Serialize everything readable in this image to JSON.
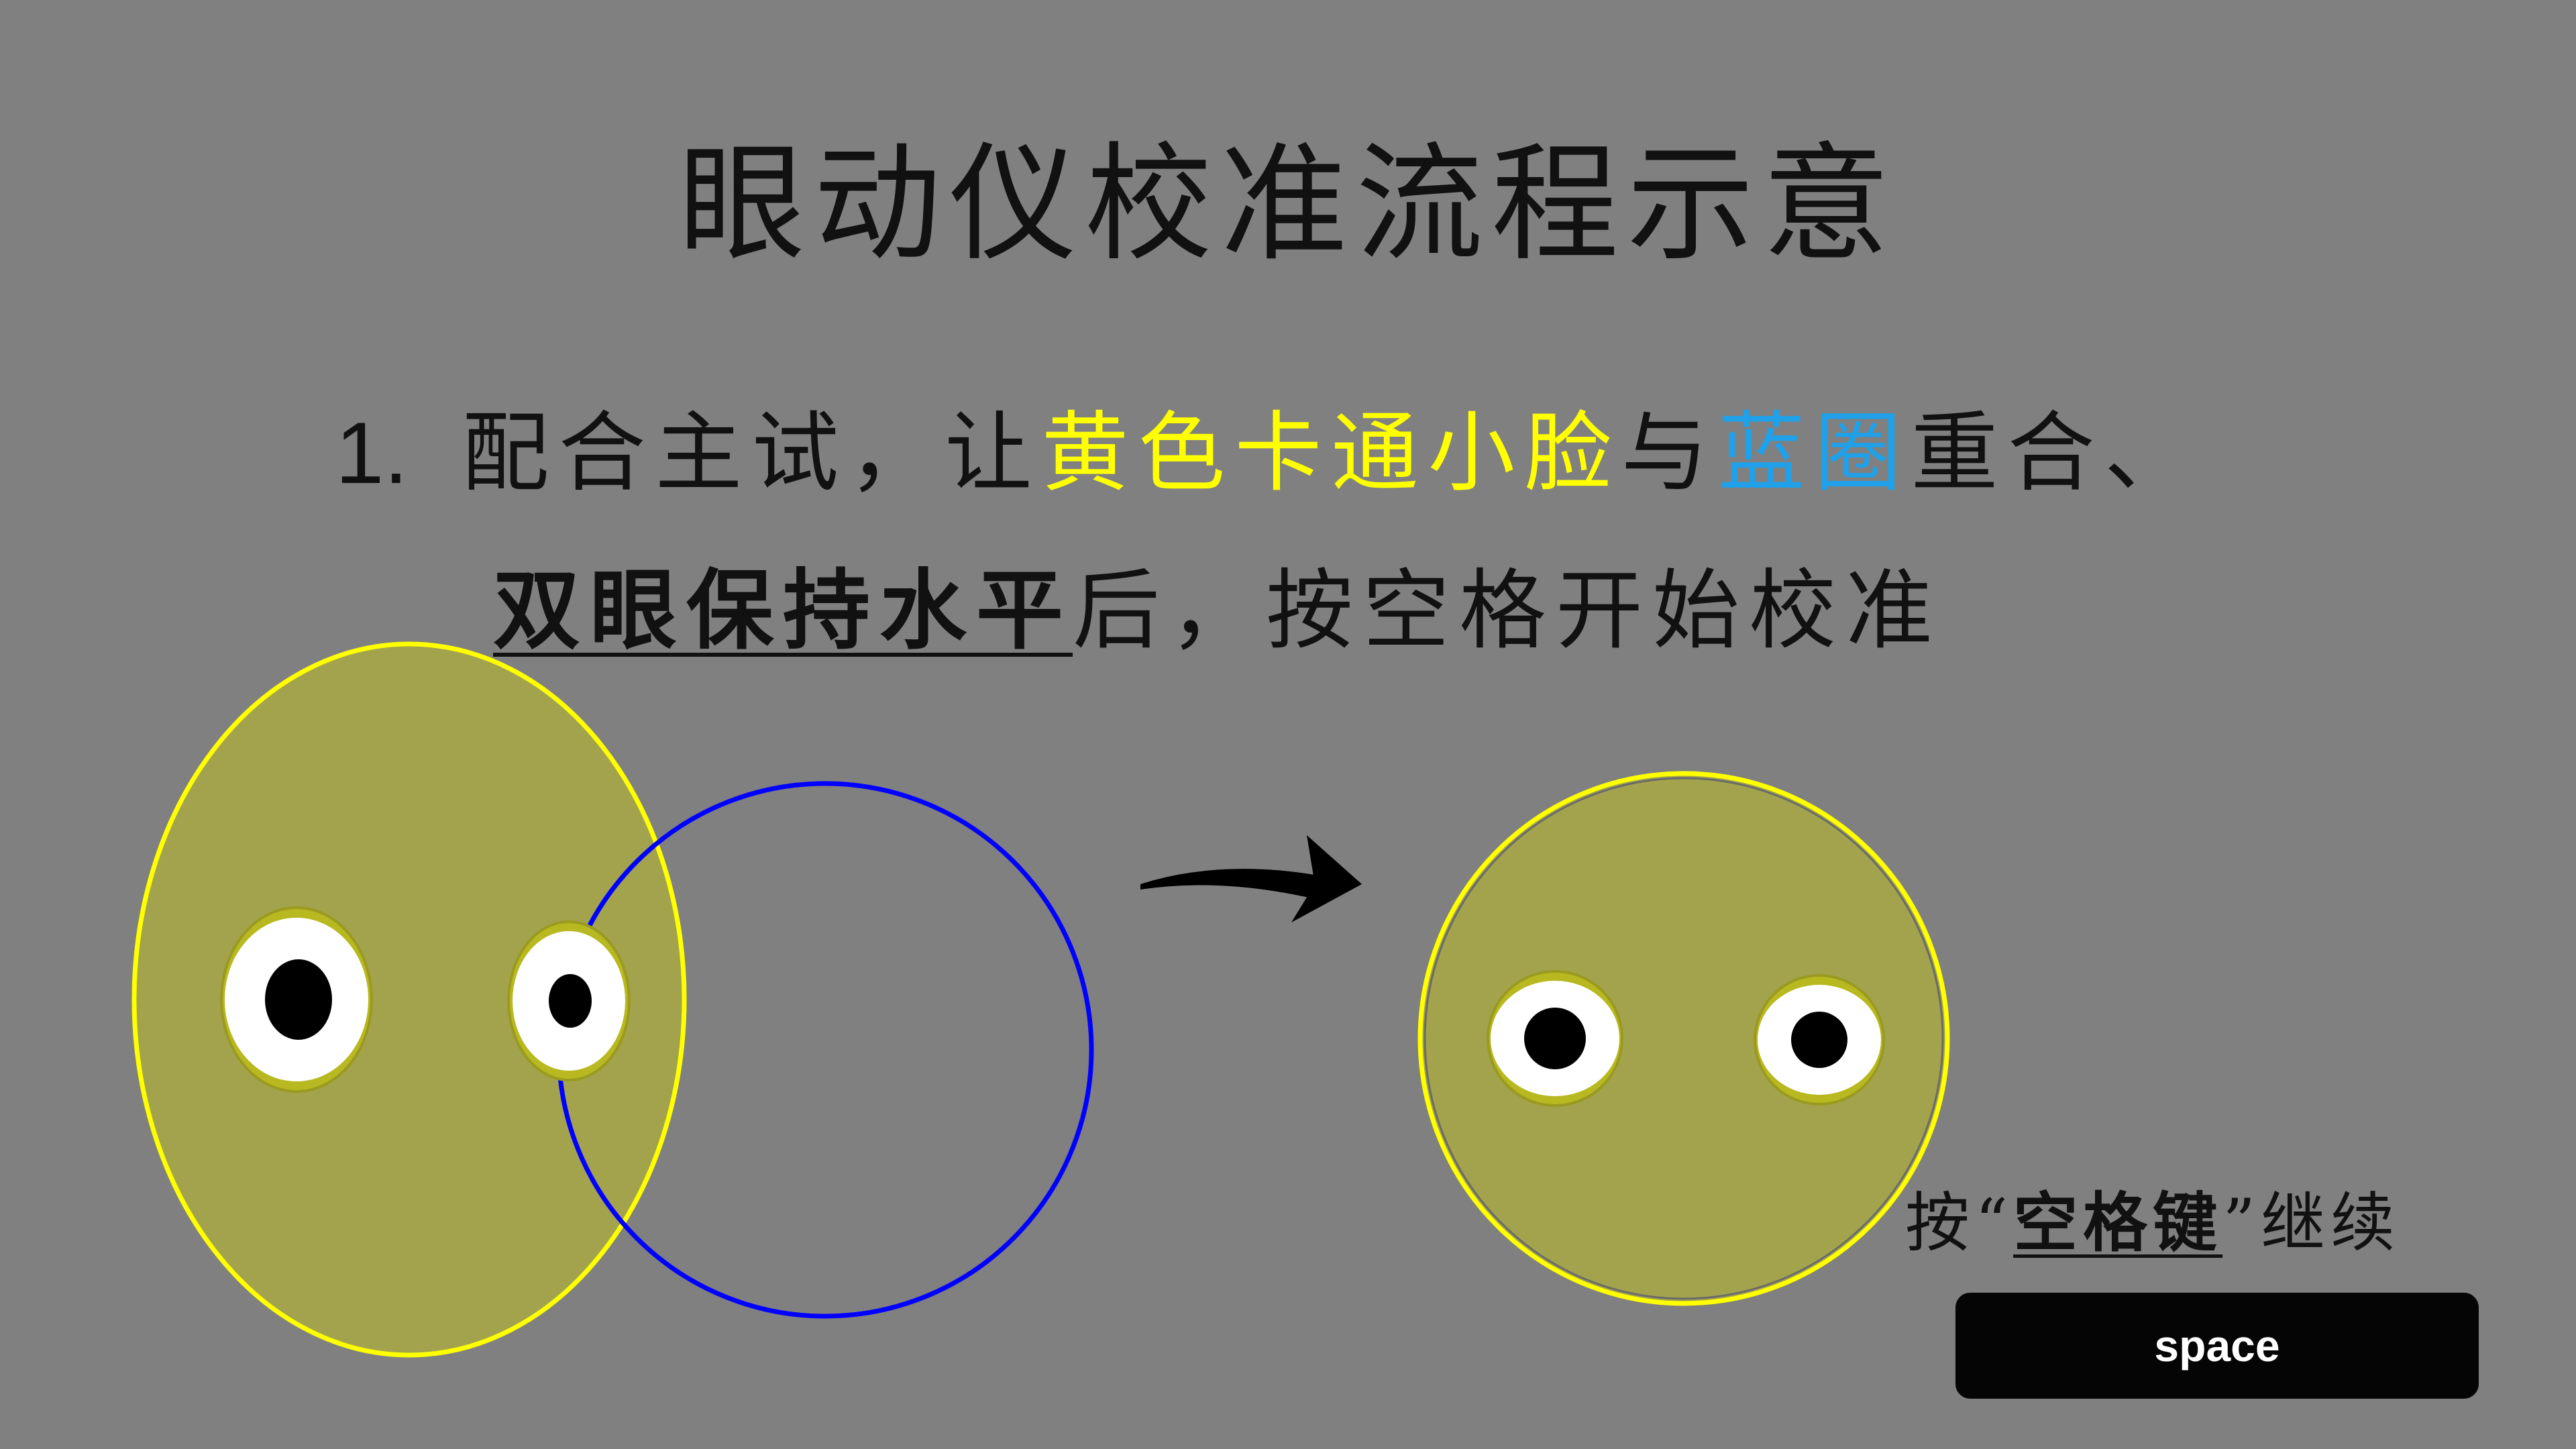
{
  "title": "眼动仪校准流程示意",
  "instruction": {
    "number": "1.",
    "part1": "配合主试，让",
    "yellow_text": "黄色卡通小脸",
    "connector": "与",
    "blue_text": "蓝圈",
    "part2": "重合、",
    "emphasis": "双眼保持水平",
    "part3": "后，按空格开始校准"
  },
  "hint": {
    "prefix": "按“",
    "key": "空格键",
    "suffix": "”继续"
  },
  "space_button": {
    "label": "space"
  },
  "colors": {
    "background": "#808080",
    "face_fill": "#a3a34e",
    "face_outline": "#ffff00",
    "target_circle": "#0000ff",
    "highlight_yellow": "#ffff00",
    "highlight_blue": "#1fa0e8"
  },
  "icons": {
    "arrow": "curved-arrow-right-icon"
  }
}
